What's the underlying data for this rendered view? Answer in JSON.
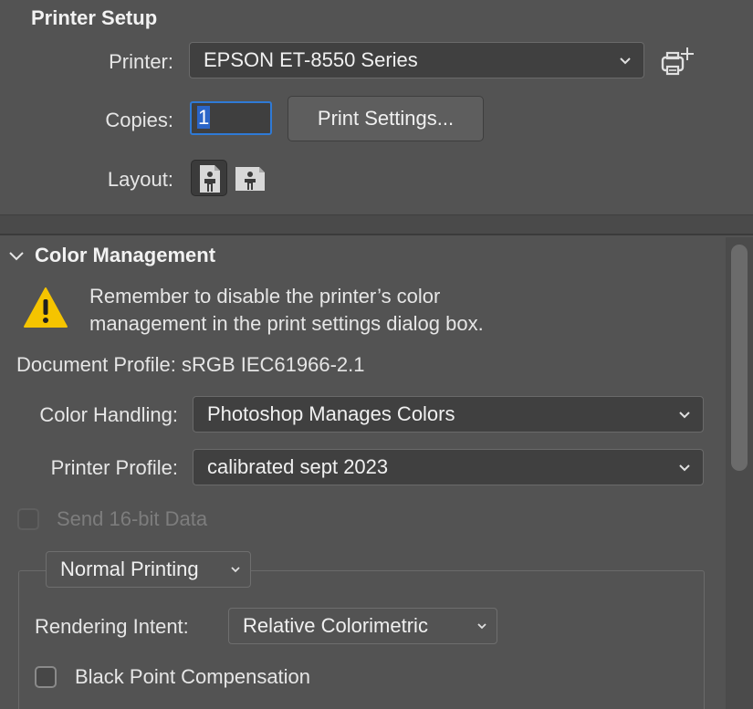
{
  "printer_setup": {
    "title": "Printer Setup",
    "printer_label": "Printer:",
    "printer_value": "EPSON ET-8550 Series",
    "copies_label": "Copies:",
    "copies_value": "1",
    "print_settings_button": "Print Settings...",
    "layout_label": "Layout:",
    "layout_options": [
      "portrait-icon",
      "landscape-icon"
    ],
    "layout_selected": "portrait"
  },
  "color_management": {
    "title": "Color Management",
    "warning_line1": "Remember to disable the printer’s color",
    "warning_line2": "management in the print settings dialog box.",
    "document_profile": "Document Profile: sRGB IEC61966-2.1",
    "color_handling_label": "Color Handling:",
    "color_handling_value": "Photoshop Manages Colors",
    "printer_profile_label": "Printer Profile:",
    "printer_profile_value": "calibrated sept 2023",
    "send_16bit_label": "Send 16-bit Data",
    "send_16bit_checked": false,
    "send_16bit_enabled": false,
    "printing_mode": "Normal Printing",
    "rendering_intent_label": "Rendering Intent:",
    "rendering_intent_value": "Relative Colorimetric",
    "black_point_label": "Black Point Compensation",
    "black_point_checked": false
  },
  "colors": {
    "panel_bg": "#535353",
    "field_bg": "#404040",
    "focus_ring": "#2f7ad6",
    "warning_yellow": "#f5c400"
  }
}
